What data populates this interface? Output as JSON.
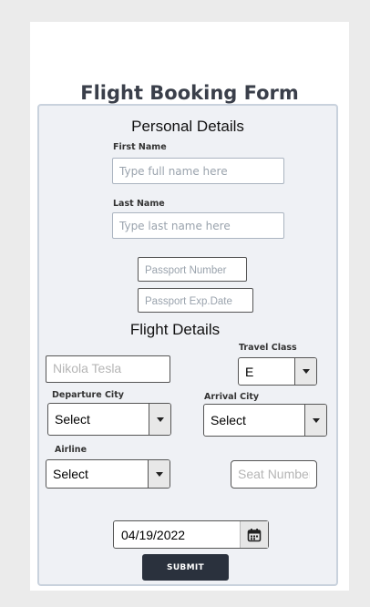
{
  "form": {
    "title": "Flight Booking Form",
    "personal": {
      "heading": "Personal Details",
      "first_name_label": "First Name",
      "first_name_placeholder": "Type full name here",
      "last_name_label": "Last Name",
      "last_name_placeholder": "Type last name here",
      "passport_placeholder": "Passport Number",
      "passport_exp_placeholder": "Passport Exp.Date"
    },
    "flight": {
      "heading": "Flight Details",
      "name_placeholder": "Nikola Tesla",
      "travel_class_label": "Travel Class",
      "travel_class_value": "E",
      "departure_label": "Departure City",
      "departure_value": "Select",
      "arrival_label": "Arrival City",
      "arrival_value": "Select",
      "airline_label": "Airline",
      "airline_value": "Select",
      "seat_placeholder": "Seat Number",
      "date_value": "04/19/2022"
    },
    "submit_label": "SUBMIT"
  }
}
